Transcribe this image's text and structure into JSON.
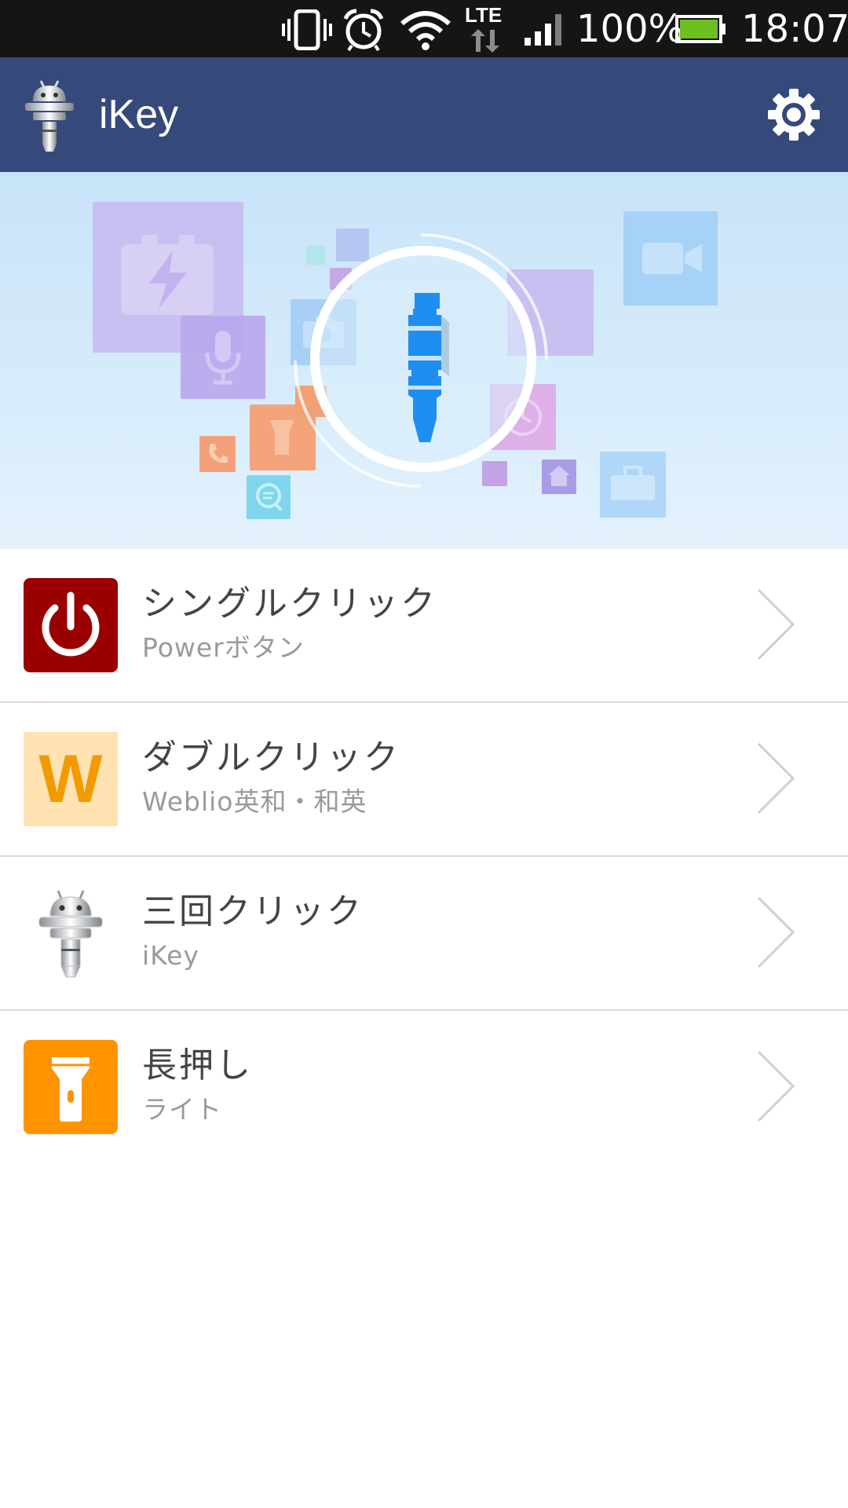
{
  "status_bar": {
    "battery_text": "100%",
    "time": "18:07",
    "network_label": "LTE",
    "icons": [
      "vibrate-icon",
      "alarm-icon",
      "wifi-icon",
      "lte-data-icon",
      "signal-icon",
      "battery-icon"
    ],
    "battery_color": "#6dc020"
  },
  "app_bar": {
    "title": "iKey",
    "logo_icon": "ikey-logo-icon",
    "settings_icon": "gear-icon",
    "background": "#354a7a"
  },
  "banner": {
    "center_icon": "earphone-plug-icon",
    "accent": "#1e8ff0"
  },
  "actions": [
    {
      "title": "シングルクリック",
      "subtitle": "Powerボタン",
      "icon": "power-icon",
      "icon_color": "#9b0000"
    },
    {
      "title": "ダブルクリック",
      "subtitle": "Weblio英和・和英",
      "icon": "weblio-icon",
      "icon_letter": "W",
      "icon_color": "#ffe3b3"
    },
    {
      "title": "三回クリック",
      "subtitle": "iKey",
      "icon": "ikey-icon"
    },
    {
      "title": "長押し",
      "subtitle": "ライト",
      "icon": "flashlight-icon",
      "icon_color": "#ff9400"
    }
  ]
}
